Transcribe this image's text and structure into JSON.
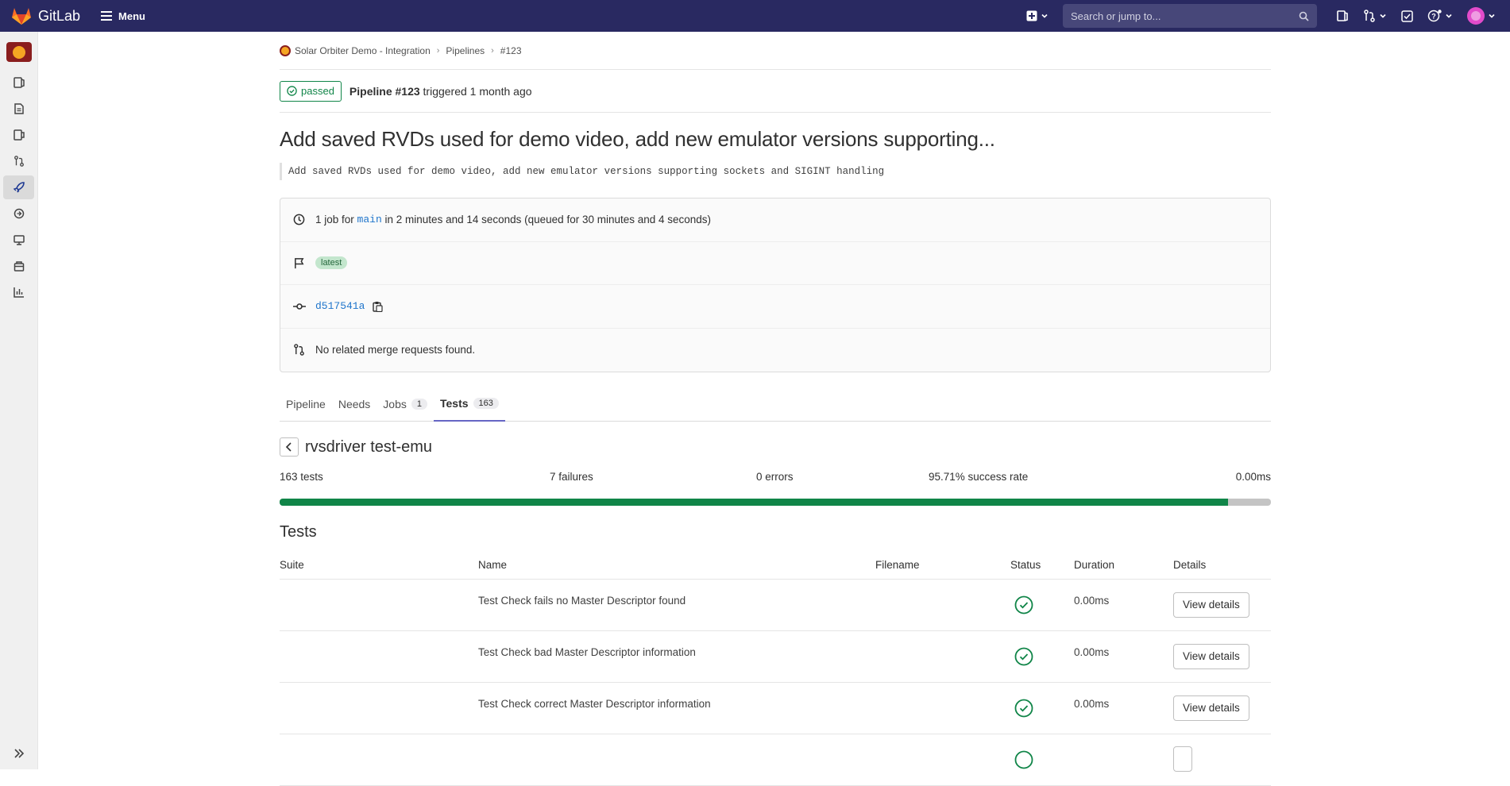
{
  "app": {
    "name": "GitLab",
    "menu_label": "Menu"
  },
  "search": {
    "placeholder": "Search or jump to..."
  },
  "breadcrumb": {
    "project": "Solar Orbiter Demo - Integration",
    "section": "Pipelines",
    "current": "#123"
  },
  "pipeline": {
    "status": "passed",
    "title": "Pipeline #123",
    "triggered_text": "triggered 1 month ago",
    "commit_title": "Add saved RVDs used for demo video, add new emulator versions supporting...",
    "commit_description": "Add saved RVDs used for demo video, add new emulator versions supporting sockets and SIGINT handling",
    "jobs_prefix": "1 job for",
    "branch": "main",
    "jobs_suffix": "in 2 minutes and 14 seconds (queued for 30 minutes and 4 seconds)",
    "tag": "latest",
    "commit_sha": "d517541a",
    "merge_requests": "No related merge requests found."
  },
  "tabs": [
    {
      "label": "Pipeline"
    },
    {
      "label": "Needs"
    },
    {
      "label": "Jobs",
      "count": "1"
    },
    {
      "label": "Tests",
      "count": "163"
    }
  ],
  "suite": {
    "title": "rvsdriver test-emu",
    "tests": "163 tests",
    "failures": "7 failures",
    "errors": "0 errors",
    "success_rate": "95.71% success rate",
    "duration": "0.00ms",
    "success_fraction": 0.9571
  },
  "tests_section": {
    "title": "Tests",
    "headers": {
      "suite": "Suite",
      "name": "Name",
      "filename": "Filename",
      "status": "Status",
      "duration": "Duration",
      "details": "Details"
    },
    "rows": [
      {
        "suite": "",
        "name": "Test Check fails no Master Descriptor found",
        "filename": "",
        "status": "success",
        "duration": "0.00ms",
        "action": "View details"
      },
      {
        "suite": "",
        "name": "Test Check bad Master Descriptor information",
        "filename": "",
        "status": "success",
        "duration": "0.00ms",
        "action": "View details"
      },
      {
        "suite": "",
        "name": "Test Check correct Master Descriptor information",
        "filename": "",
        "status": "success",
        "duration": "0.00ms",
        "action": "View details"
      }
    ]
  },
  "colors": {
    "topbar": "#292961",
    "success": "#108548",
    "link": "#1f75cb",
    "tab_active": "#6666c4"
  }
}
